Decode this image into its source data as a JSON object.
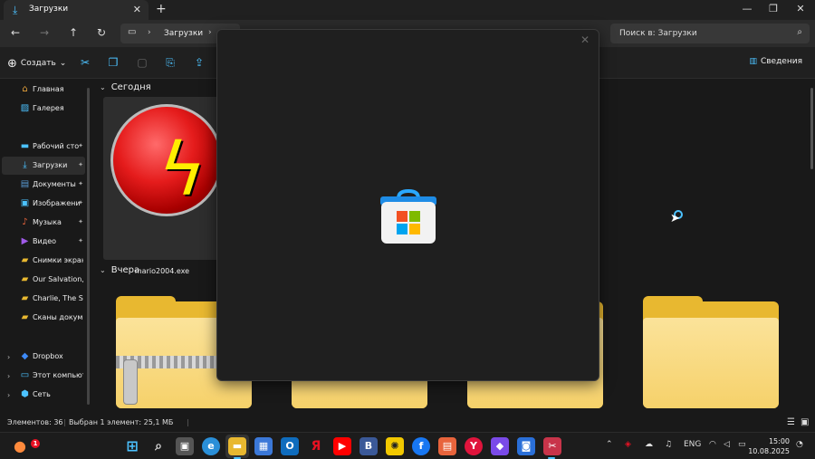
{
  "window": {
    "tab_title": "Загрузки",
    "tab_icon": "download-icon",
    "new_tab_label": "+",
    "minimize_label": "—",
    "maximize_label": "❐",
    "close_label": "✕"
  },
  "navbar": {
    "path_segment": "Загрузки",
    "search_placeholder": "Поиск в: Загрузки"
  },
  "toolbar": {
    "create_label": "Создать",
    "details_label": "Сведения"
  },
  "sidebar": {
    "items": [
      {
        "label": "Главная",
        "icon": "home-icon",
        "color": "#e8a33c"
      },
      {
        "label": "Галерея",
        "icon": "gallery-icon",
        "color": "#4cc2ff"
      },
      {
        "label": "Рабочий сто",
        "icon": "desktop-icon",
        "color": "#4cc2ff"
      },
      {
        "label": "Загрузки",
        "icon": "download-icon",
        "color": "#4cc2ff"
      },
      {
        "label": "Документы",
        "icon": "document-icon",
        "color": "#5b9bd5"
      },
      {
        "label": "Изображени",
        "icon": "image-icon",
        "color": "#4cc2ff"
      },
      {
        "label": "Музыка",
        "icon": "music-icon",
        "color": "#e8643c"
      },
      {
        "label": "Видео",
        "icon": "video-icon",
        "color": "#a05ae8"
      },
      {
        "label": "Снимки экрана",
        "icon": "folder-icon",
        "color": "#e8b830"
      },
      {
        "label": "Our Salvation, C",
        "icon": "folder-icon",
        "color": "#e8b830"
      },
      {
        "label": "Charlie, The Ste",
        "icon": "folder-icon",
        "color": "#e8b830"
      },
      {
        "label": "Сканы докумен",
        "icon": "folder-icon",
        "color": "#e8b830"
      },
      {
        "label": "Dropbox",
        "icon": "dropbox-icon",
        "color": "#3d8af7"
      },
      {
        "label": "Этот компьюте",
        "icon": "computer-icon",
        "color": "#4cc2ff"
      },
      {
        "label": "Сеть",
        "icon": "network-icon",
        "color": "#4cc2ff"
      }
    ]
  },
  "content": {
    "group_today": "Сегодня",
    "group_yesterday": "Вчера",
    "file_name": "mario2004.exe"
  },
  "status": {
    "item_count": "Элементов: 36",
    "selection": "Выбран 1 элемент: 25,1 МБ"
  },
  "taskbar": {
    "weather_badge": "1",
    "language": "ENG",
    "time": "15:00",
    "date": "10.08.2025",
    "apps": [
      {
        "name": "start-icon",
        "color": "#4cc2ff",
        "glyph": "⊞"
      },
      {
        "name": "search-icon",
        "color": "#1c1c1c",
        "glyph": "⌕"
      },
      {
        "name": "task-view-icon",
        "color": "#555",
        "glyph": "▣"
      },
      {
        "name": "edge-icon",
        "color": "#2a8fd8",
        "glyph": "e"
      },
      {
        "name": "file-explorer-icon",
        "color": "#e8b830",
        "glyph": "▬"
      },
      {
        "name": "microsoft-store-icon",
        "color": "#3b78d8",
        "glyph": "▦"
      },
      {
        "name": "outlook-icon",
        "color": "#0f6cbd",
        "glyph": "O"
      },
      {
        "name": "yandex-icon",
        "color": "#e81123",
        "glyph": "Я"
      },
      {
        "name": "youtube-icon",
        "color": "#ff0000",
        "glyph": "▶"
      },
      {
        "name": "vk-icon",
        "color": "#3b5998",
        "glyph": "B"
      },
      {
        "name": "bee-icon",
        "color": "#f2c800",
        "glyph": "✺"
      },
      {
        "name": "facebook-icon",
        "color": "#1877f2",
        "glyph": "f"
      },
      {
        "name": "notes-icon",
        "color": "#e8643c",
        "glyph": "▤"
      },
      {
        "name": "yandex-browser-icon",
        "color": "#e0143c",
        "glyph": "Y"
      },
      {
        "name": "game-icon",
        "color": "#7a4ae8",
        "glyph": "◆"
      },
      {
        "name": "remote-icon",
        "color": "#2a6fd8",
        "glyph": "◙"
      },
      {
        "name": "screenshot-tool-icon",
        "color": "#c8344a",
        "glyph": "✂"
      }
    ]
  }
}
